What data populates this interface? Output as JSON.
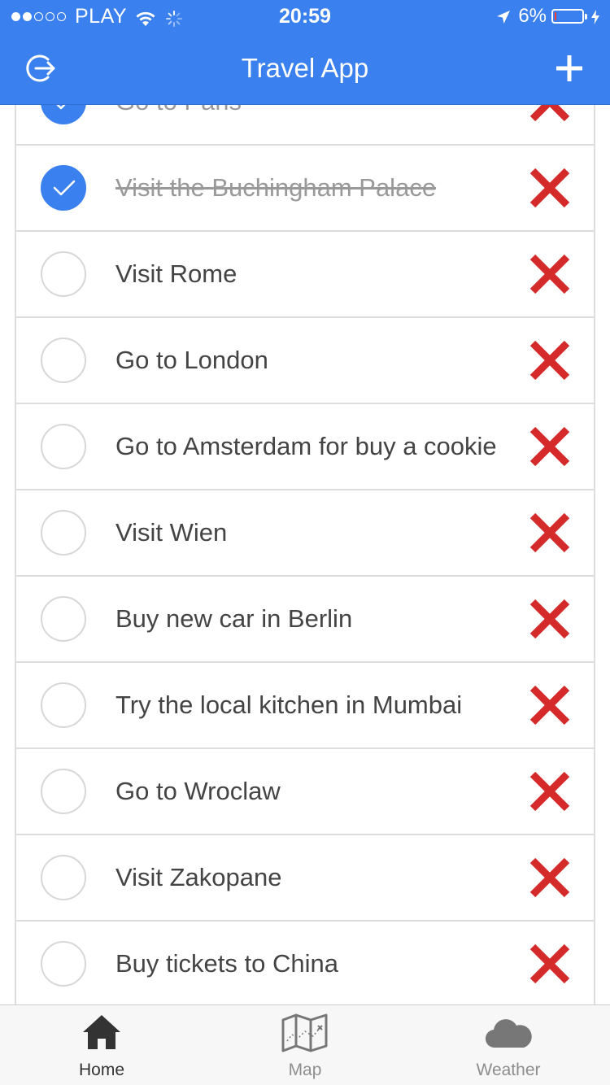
{
  "status_bar": {
    "carrier": "PLAY",
    "signal_bars_filled": 2,
    "signal_bars_total": 5,
    "time": "20:59",
    "battery_percent": "6%",
    "battery_level": 0.06
  },
  "header": {
    "title": "Travel App",
    "left_icon": "logout-icon",
    "right_icon": "add-icon",
    "background_color": "#3a80ee"
  },
  "todos": [
    {
      "label": "Go to Paris",
      "done": true
    },
    {
      "label": "Visit the Buchingham Palace",
      "done": true
    },
    {
      "label": "Visit Rome",
      "done": false
    },
    {
      "label": "Go to London",
      "done": false
    },
    {
      "label": "Go to Amsterdam for buy a cookie",
      "done": false
    },
    {
      "label": "Visit Wien",
      "done": false
    },
    {
      "label": "Buy new car in Berlin",
      "done": false
    },
    {
      "label": "Try the local kitchen in Mumbai",
      "done": false
    },
    {
      "label": "Go to Wroclaw",
      "done": false
    },
    {
      "label": "Visit Zakopane",
      "done": false
    },
    {
      "label": "Buy tickets to China",
      "done": false
    },
    {
      "label": "",
      "done": false
    }
  ],
  "tabs": [
    {
      "label": "Home",
      "icon": "home-icon",
      "active": true
    },
    {
      "label": "Map",
      "icon": "map-icon",
      "active": false
    },
    {
      "label": "Weather",
      "icon": "cloud-icon",
      "active": false
    }
  ],
  "colors": {
    "accent": "#3a80ee",
    "delete": "#d42a2a",
    "done_text": "#999999",
    "text": "#444444"
  }
}
